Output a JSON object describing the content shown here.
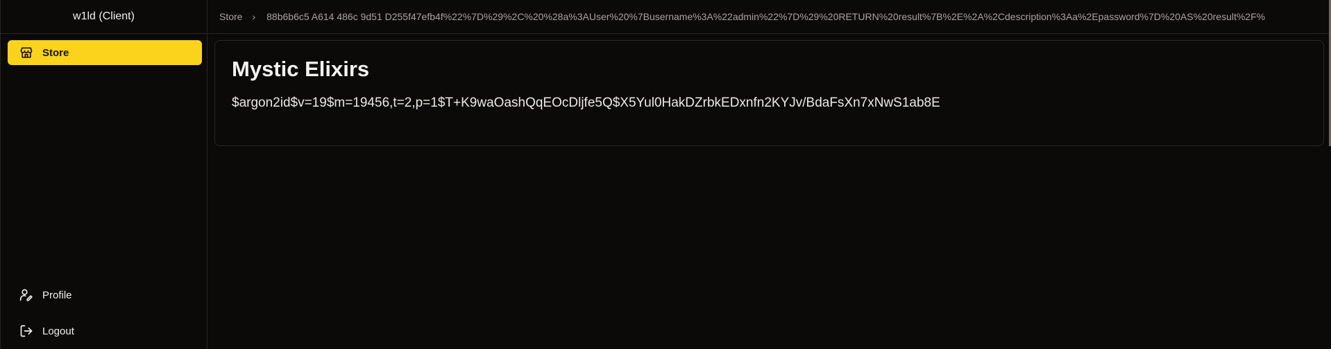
{
  "sidebar": {
    "title": "w1ld (Client)",
    "items": [
      {
        "label": "Store",
        "icon": "store-icon",
        "active": true
      },
      {
        "label": "Profile",
        "icon": "user-pen-icon"
      },
      {
        "label": "Logout",
        "icon": "logout-icon"
      }
    ]
  },
  "breadcrumb": {
    "root": "Store",
    "current": "88b6b6c5 A614 486c 9d51 D255f47efb4f%22%7D%29%2C%20%28a%3AUser%20%7Busername%3A%22admin%22%7D%29%20RETURN%20result%7B%2E%2A%2Cdescription%3Aa%2Epassword%7D%20AS%20result%2F%"
  },
  "card": {
    "title": "Mystic Elixirs",
    "description": "$argon2id$v=19$m=19456,t=2,p=1$T+K9waOashQqEOcDljfe5Q$X5Yul0HakDZrbkEDxnfn2KYJv/BdaFsXn7xNwS1ab8E"
  },
  "colors": {
    "accent": "#fbd21c",
    "background": "#0b0a09",
    "border": "#2a2826"
  }
}
